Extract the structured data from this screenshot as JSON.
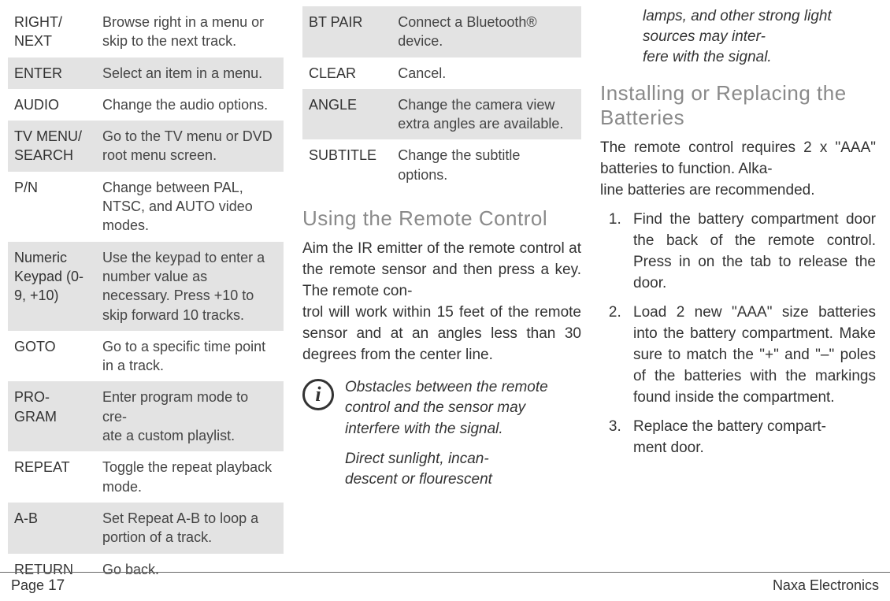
{
  "col1_table": [
    {
      "label": "RIGHT/\nNEXT",
      "desc": "Browse right in a menu or skip to the next track.",
      "shade": false
    },
    {
      "label": "ENTER",
      "desc": "Select an item in a menu.",
      "shade": true
    },
    {
      "label": "AUDIO",
      "desc": "Change the audio options.",
      "shade": false
    },
    {
      "label": "TV MENU/\nSEARCH",
      "desc": "Go to the TV menu or DVD root menu screen.",
      "shade": true
    },
    {
      "label": "P/N",
      "desc": "Change between PAL, NTSC, and AUTO video modes.",
      "shade": false
    },
    {
      "label": "Numeric Keypad (0-9, +10)",
      "desc": "Use the keypad to enter a number value as necessary. Press +10 to skip forward 10 tracks.",
      "shade": true
    },
    {
      "label": "GOTO",
      "desc": "Go to a specific time point in a track.",
      "shade": false
    },
    {
      "label": "PRO-\nGRAM",
      "desc": "Enter program mode to cre-\nate a custom playlist.",
      "shade": true
    },
    {
      "label": "REPEAT",
      "desc": "Toggle the repeat playback mode.",
      "shade": false
    },
    {
      "label": "A-B",
      "desc": "Set Repeat A-B to loop a portion of a track.",
      "shade": true
    },
    {
      "label": "RETURN",
      "desc": "Go back.",
      "shade": false
    }
  ],
  "col2_table": [
    {
      "label": "BT PAIR",
      "desc": "Connect a Bluetooth® device.",
      "shade": true
    },
    {
      "label": "CLEAR",
      "desc": "Cancel.",
      "shade": false
    },
    {
      "label": "ANGLE",
      "desc": "Change the camera view extra angles are available.",
      "shade": true
    },
    {
      "label": "SUBTITLE",
      "desc": "Change the subtitle options.",
      "shade": false
    }
  ],
  "headings": {
    "using_remote": "Using the Remote Control",
    "installing": "Installing or Replacing the Batteries"
  },
  "using_remote_body": "Aim the IR emitter of the remote control at the remote sensor and then press a key. The remote con-\ntrol will work within 15 feet of the remote sensor and at an angles less than 30 degrees from the center line.",
  "info_icon": "i",
  "info_note1": "Obstacles between the remote control and the sensor may interfere with the signal.",
  "info_note2": "Direct sunlight, incan-\ndescent or flourescent",
  "info_note2_cont": "lamps, and other strong light sources may inter-\nfere with the signal.",
  "batteries_intro": "The remote control requires 2 x \"AAA\" batteries to function. Alka-\nline batteries are recommended.",
  "steps": [
    "Find the battery compartment door the back of the remote control. Press in on the tab to release the door.",
    "Load 2 new \"AAA\" size batteries into the battery compartment. Make sure to match the \"+\" and \"–\" poles of the batteries with the markings found inside the compartment.",
    "Replace the battery compart-\nment door."
  ],
  "footer": {
    "page_label": "Page",
    "page_num": "17",
    "brand": "Naxa Electronics"
  }
}
